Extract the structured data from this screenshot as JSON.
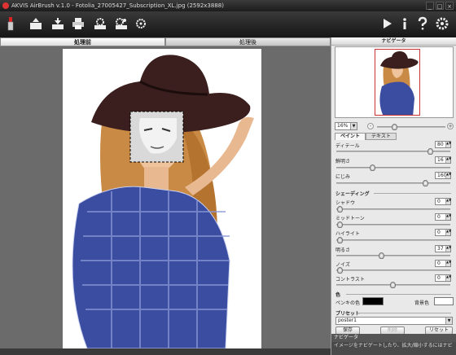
{
  "window": {
    "title": "AKVIS AirBrush v.1.0 - Fotolia_27005427_Subscription_XL.jpg (2592x3888)",
    "buttons": [
      "_",
      "□",
      "×"
    ]
  },
  "toolbar": {
    "left_icons": [
      "brush-logo-icon",
      "open-icon",
      "save-icon",
      "print-icon",
      "settings-gear-icon",
      "presets-gear-icon",
      "star-gear-icon"
    ],
    "right_icons": [
      "run-icon",
      "info-icon",
      "help-icon",
      "preferences-icon"
    ]
  },
  "canvas": {
    "tab_before": "処理前",
    "tab_after": "処理後"
  },
  "navigator": {
    "title": "ナビゲータ",
    "zoom": "16%",
    "zoom_level": 0.3
  },
  "settings": {
    "tab_paint": "ペイント",
    "tab_text": "テキスト",
    "detail_label": "ディテール",
    "detail_value": "80",
    "detail_level": 0.8,
    "sharpness_label": "鮮明さ",
    "sharpness_value": "16",
    "sharpness_level": 0.16,
    "blur_label": "にじみ",
    "blur_value": "160",
    "blur_level": 0.8,
    "shading_title": "シェーディング",
    "shadows_label": "シャドウ",
    "shadows_value": "0",
    "midtones_label": "ミッドトーン",
    "midtones_value": "0",
    "highlights_label": "ハイライト",
    "highlights_value": "0",
    "brightness_label": "明るさ",
    "brightness_value": "37",
    "brightness_level": 0.37,
    "noise_label": "ノイズ",
    "noise_value": "0",
    "contrast_label": "コントラスト",
    "contrast_value": "0",
    "color_title": "色",
    "paint_color_label": "ペンキの色",
    "paint_color": "#000000",
    "bg_color_label": "背景色",
    "bg_color": "#ffffff"
  },
  "presets": {
    "title": "プリセット",
    "current": "poster1",
    "save": "保存",
    "delete": "削除",
    "reset": "リセット"
  },
  "help": {
    "title": "ナビゲータ",
    "text": "イメージをナビゲートしたり、拡大/縮小するにはナビ"
  }
}
